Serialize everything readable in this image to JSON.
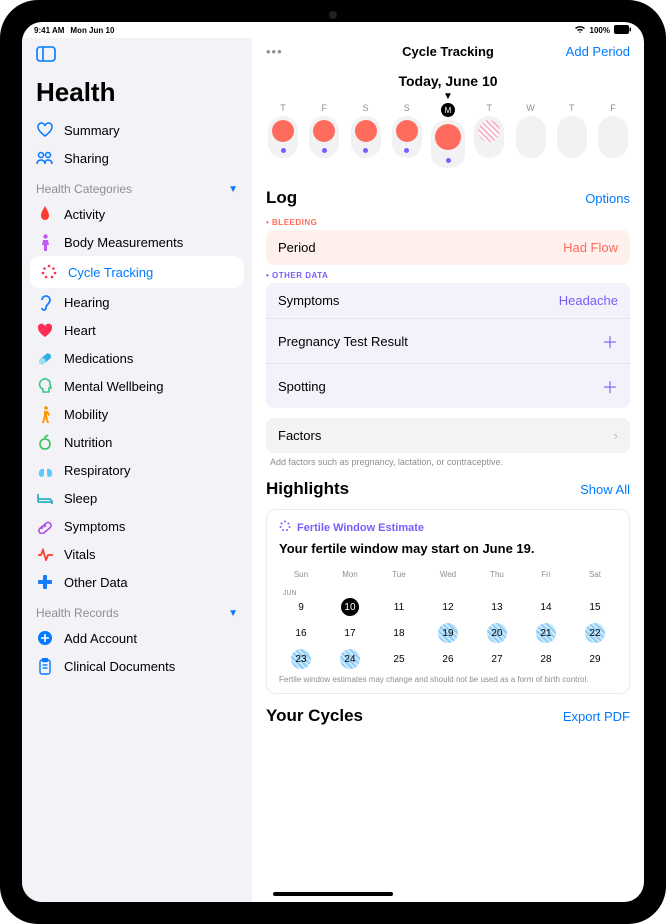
{
  "statusbar": {
    "time": "9:41 AM",
    "date": "Mon Jun 10",
    "battery": "100%"
  },
  "sidebar": {
    "title": "Health",
    "summary": "Summary",
    "sharing": "Sharing",
    "categories_header": "Health Categories",
    "categories": [
      "Activity",
      "Body Measurements",
      "Cycle Tracking",
      "Hearing",
      "Heart",
      "Medications",
      "Mental Wellbeing",
      "Mobility",
      "Nutrition",
      "Respiratory",
      "Sleep",
      "Symptoms",
      "Vitals",
      "Other Data"
    ],
    "records_header": "Health Records",
    "add_account": "Add Account",
    "clinical_docs": "Clinical Documents"
  },
  "main": {
    "title": "Cycle Tracking",
    "add_period": "Add Period",
    "today_label": "Today, June 10",
    "days": [
      {
        "label": "T",
        "period": true,
        "logged": true,
        "today": false
      },
      {
        "label": "F",
        "period": true,
        "logged": true,
        "today": false
      },
      {
        "label": "S",
        "period": true,
        "logged": true,
        "today": false
      },
      {
        "label": "S",
        "period": true,
        "logged": true,
        "today": false
      },
      {
        "label": "M",
        "period": true,
        "logged": true,
        "today": true
      },
      {
        "label": "T",
        "period": false,
        "hatch": true,
        "logged": false,
        "today": false
      },
      {
        "label": "W",
        "period": false,
        "logged": false,
        "today": false
      },
      {
        "label": "T",
        "period": false,
        "logged": false,
        "today": false
      },
      {
        "label": "F",
        "period": false,
        "logged": false,
        "today": false
      }
    ],
    "log": {
      "title": "Log",
      "options": "Options",
      "bleeding_header": "BLEEDING",
      "period_label": "Period",
      "period_value": "Had Flow",
      "other_header": "OTHER DATA",
      "symptoms_label": "Symptoms",
      "symptoms_value": "Headache",
      "preg_label": "Pregnancy Test Result",
      "spotting_label": "Spotting",
      "factors_label": "Factors",
      "factors_hint": "Add factors such as pregnancy, lactation, or contraceptive."
    },
    "highlights": {
      "title": "Highlights",
      "show_all": "Show All",
      "fertile_title": "Fertile Window Estimate",
      "fertile_msg": "Your fertile window may start on June 19.",
      "weekdays": [
        "Sun",
        "Mon",
        "Tue",
        "Wed",
        "Thu",
        "Fri",
        "Sat"
      ],
      "month_label": "JUN",
      "grid": [
        [
          {
            "d": 9
          },
          {
            "d": 10,
            "today": true
          },
          {
            "d": 11
          },
          {
            "d": 12
          },
          {
            "d": 13
          },
          {
            "d": 14
          },
          {
            "d": 15
          }
        ],
        [
          {
            "d": 16
          },
          {
            "d": 17
          },
          {
            "d": 18
          },
          {
            "d": 19,
            "f": true
          },
          {
            "d": 20,
            "f": true
          },
          {
            "d": 21,
            "f": true
          },
          {
            "d": 22,
            "f": true
          }
        ],
        [
          {
            "d": 23,
            "f": true
          },
          {
            "d": 24,
            "f": true
          },
          {
            "d": 25
          },
          {
            "d": 26
          },
          {
            "d": 27
          },
          {
            "d": 28
          },
          {
            "d": 29
          }
        ]
      ],
      "disclaimer": "Fertile window estimates may change and should not be used as a form of birth control."
    },
    "cycles_title": "Your Cycles",
    "export": "Export PDF"
  },
  "colors": {
    "accent": "#007aff",
    "period": "#ff6b5c",
    "purple": "#7a5cff"
  },
  "icon_colors": {
    "activity": "#ff3b30",
    "body": "#bf5af2",
    "cycle": "#007aff",
    "hearing": "#147efb",
    "heart": "#ff2d55",
    "meds": "#32ade6",
    "mental": "#34c788",
    "mobility": "#ff9500",
    "nutrition": "#34c759",
    "resp": "#5ac8fa",
    "sleep": "#30b0c7",
    "symptoms": "#af52de",
    "vitals": "#ff3b30",
    "other": "#147efb",
    "summary": "#007aff",
    "sharing": "#007aff",
    "add": "#007aff",
    "clinical": "#007aff"
  }
}
